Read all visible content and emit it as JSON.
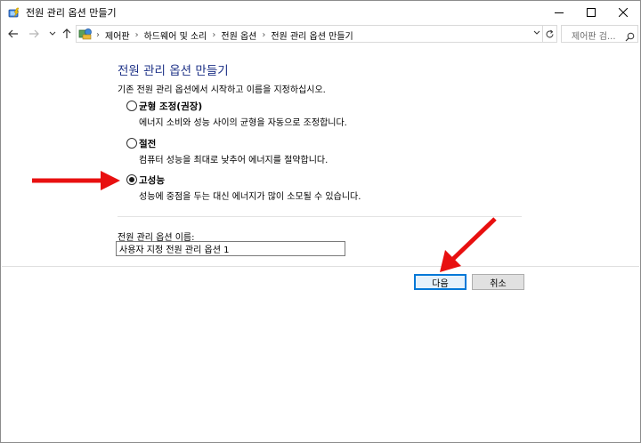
{
  "window": {
    "title": "전원 관리 옵션 만들기"
  },
  "navigation": {
    "breadcrumbs": [
      "제어판",
      "하드웨어 및 소리",
      "전원 옵션",
      "전원 관리 옵션 만들기"
    ],
    "search_placeholder": "제어판 검..."
  },
  "page": {
    "heading": "전원 관리 옵션 만들기",
    "intro": "기존 전원 관리 옵션에서 시작하고 이름을 지정하십시오."
  },
  "plans": [
    {
      "name": "균형 조정(권장)",
      "description": "에너지 소비와 성능 사이의 균형을 자동으로 조정합니다.",
      "selected": false
    },
    {
      "name": "절전",
      "description": "컴퓨터 성능을 최대로 낮추어 에너지를 절약합니다.",
      "selected": false
    },
    {
      "name": "고성능",
      "description": "성능에 중점을 두는 대신 에너지가 많이 소모될 수 있습니다.",
      "selected": true
    }
  ],
  "plan_name_field": {
    "label": "전원 관리 옵션 이름:",
    "value": "사용자 지정 전원 관리 옵션 1"
  },
  "buttons": {
    "next": "다음",
    "cancel": "취소"
  },
  "colors": {
    "heading": "#1e3287",
    "default_button_border": "#0078d7",
    "annotation_arrow": "#e81010"
  },
  "icons": {
    "title": "power-options-icon",
    "address": "control-panel-icon",
    "back": "arrow-left-icon",
    "forward": "arrow-right-icon",
    "up": "arrow-up-icon",
    "refresh": "refresh-icon",
    "search": "search-icon"
  }
}
